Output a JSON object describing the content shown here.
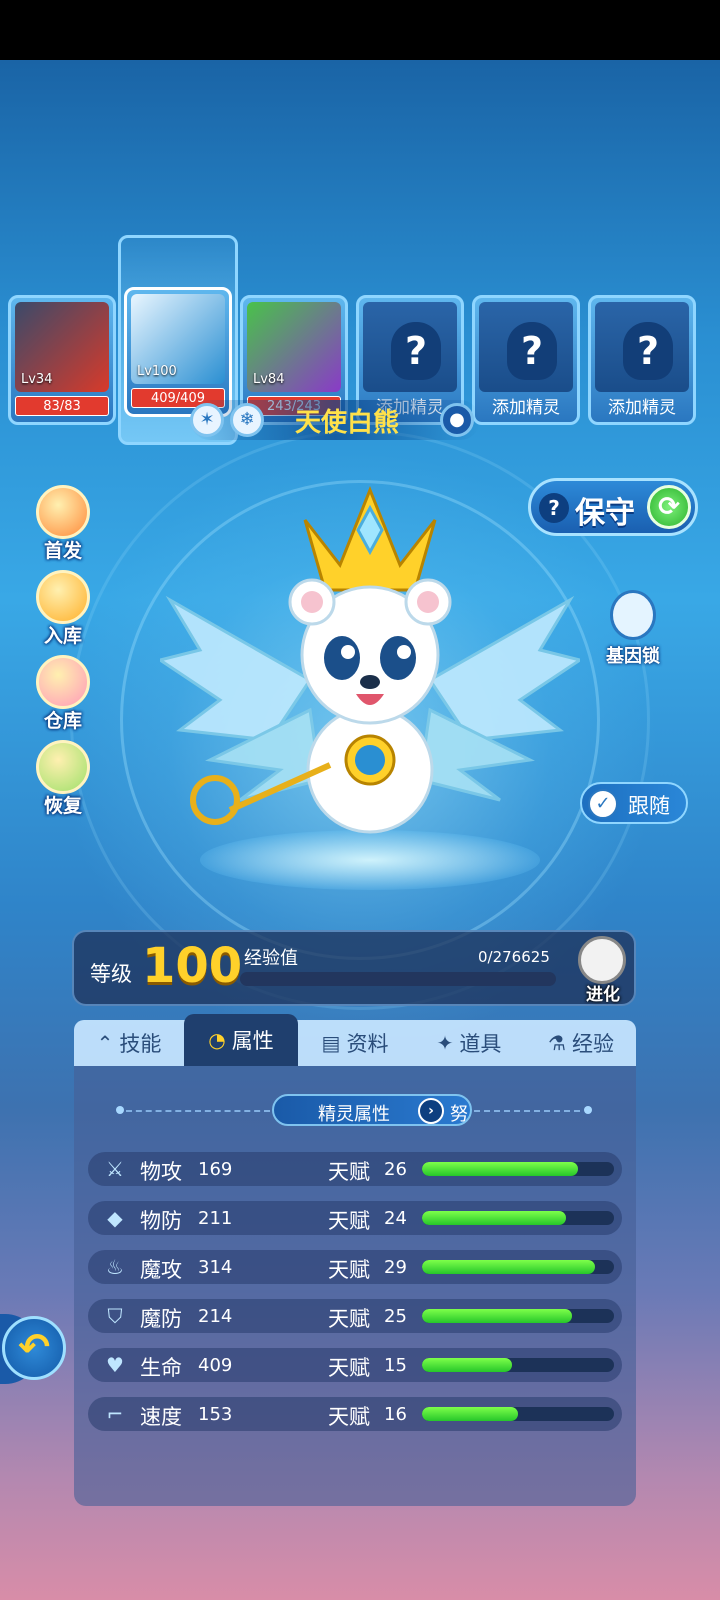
{
  "team": [
    {
      "level": "Lv34",
      "hp": "83/83",
      "filled": true,
      "portrait_colors": [
        "#3a4a6a",
        "#d83a2a"
      ]
    },
    {
      "level": "Lv100",
      "hp": "409/409",
      "filled": true,
      "selected": true,
      "portrait_colors": [
        "#e9f6ff",
        "#2a8fd2"
      ]
    },
    {
      "level": "Lv84",
      "hp": "243/243",
      "filled": true,
      "portrait_colors": [
        "#49c24a",
        "#8a3ac8"
      ]
    },
    {
      "label": "添加精灵",
      "filled": false,
      "icon": "question-icon",
      "glyph": "?"
    },
    {
      "label": "添加精灵",
      "filled": false,
      "icon": "question-icon",
      "glyph": "?"
    },
    {
      "label": "添加精灵",
      "filled": false,
      "icon": "question-icon",
      "glyph": "?"
    }
  ],
  "pet": {
    "name": "天使白熊",
    "type_icons": [
      "wind-type-icon",
      "ice-type-icon"
    ],
    "badge_icon": "pet-badge-icon"
  },
  "left_menu": [
    {
      "label": "首发",
      "icon": "starter-icon"
    },
    {
      "label": "入库",
      "icon": "store-icon"
    },
    {
      "label": "仓库",
      "icon": "warehouse-icon"
    },
    {
      "label": "恢复",
      "icon": "restore-icon"
    }
  ],
  "right_menu": {
    "guard_label": "保守",
    "guard_help": "?",
    "gene_lock_label": "基因锁",
    "follow_label": "跟随"
  },
  "level": {
    "label": "等级",
    "value": "100",
    "exp_label": "经验值",
    "exp_value": "0/276625",
    "exp_fraction": 0,
    "evolve_label": "进化"
  },
  "tabs": [
    {
      "label": "技能",
      "icon": "skill-icon",
      "glyph": "⌃"
    },
    {
      "label": "属性",
      "icon": "attribute-icon",
      "glyph": "◔",
      "active": true
    },
    {
      "label": "资料",
      "icon": "profile-icon",
      "glyph": "▤"
    },
    {
      "label": "道具",
      "icon": "item-icon",
      "glyph": "✦"
    },
    {
      "label": "经验",
      "icon": "exp-flask-icon",
      "glyph": "⚗"
    }
  ],
  "attributes": {
    "header": "精灵属性",
    "nature": "努",
    "talent_label": "天赋",
    "stats": [
      {
        "name": "物攻",
        "value": "169",
        "talent": "26",
        "fraction": 0.81,
        "icon": "sword-icon",
        "glyph": "⚔"
      },
      {
        "name": "物防",
        "value": "211",
        "talent": "24",
        "fraction": 0.75,
        "icon": "shield-icon",
        "glyph": "◆"
      },
      {
        "name": "魔攻",
        "value": "314",
        "talent": "29",
        "fraction": 0.9,
        "icon": "flame-icon",
        "glyph": "♨"
      },
      {
        "name": "魔防",
        "value": "214",
        "talent": "25",
        "fraction": 0.78,
        "icon": "magic-shield-icon",
        "glyph": "⛉"
      },
      {
        "name": "生命",
        "value": "409",
        "talent": "15",
        "fraction": 0.47,
        "icon": "heart-icon",
        "glyph": "♥"
      },
      {
        "name": "速度",
        "value": "153",
        "talent": "16",
        "fraction": 0.5,
        "icon": "boot-icon",
        "glyph": "⌐"
      }
    ]
  },
  "back_icon": "back-arrow-icon"
}
